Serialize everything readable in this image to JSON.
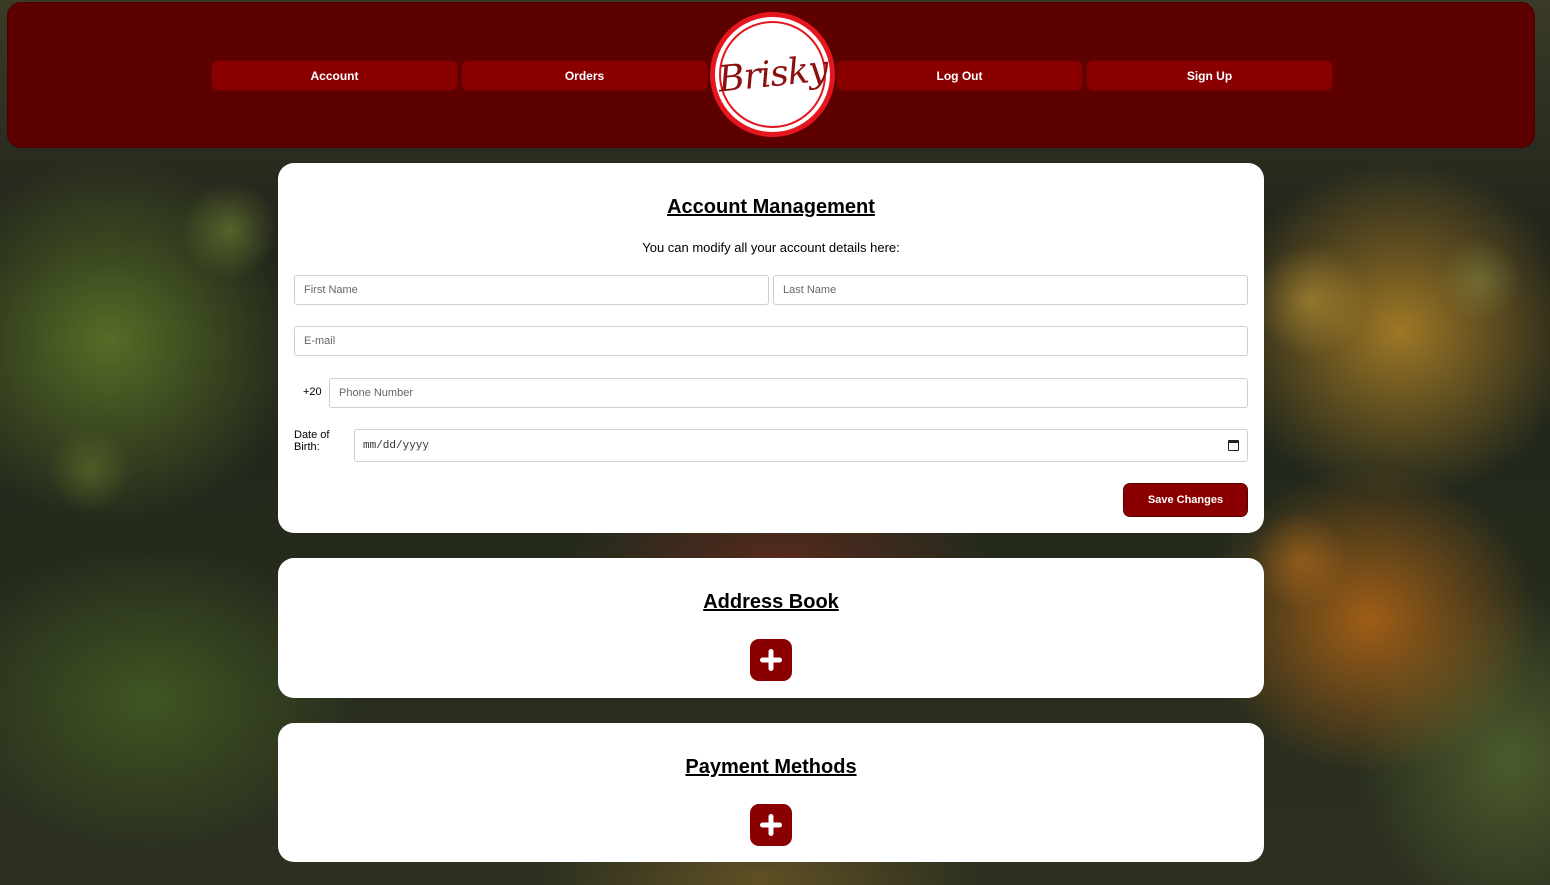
{
  "nav": {
    "account": "Account",
    "orders": "Orders",
    "logout": "Log Out",
    "signup": "Sign Up",
    "logo_text": "Brisky"
  },
  "account_management": {
    "title": "Account Management",
    "subtitle": "You can modify all your account details here:",
    "first_name_placeholder": "First Name",
    "last_name_placeholder": "Last Name",
    "email_placeholder": "E-mail",
    "phone_prefix": "+20",
    "phone_placeholder": "Phone Number",
    "dob_label": "Date of Birth:",
    "dob_placeholder": "mm/dd/yyyy",
    "save_label": "Save Changes"
  },
  "address_book": {
    "title": "Address Book",
    "add_icon": "plus-icon"
  },
  "payment_methods": {
    "title": "Payment Methods",
    "add_icon": "plus-icon"
  },
  "colors": {
    "header_bg": "#5c0000",
    "button_bg": "#8a0000",
    "logo_ring": "#e6161e"
  }
}
